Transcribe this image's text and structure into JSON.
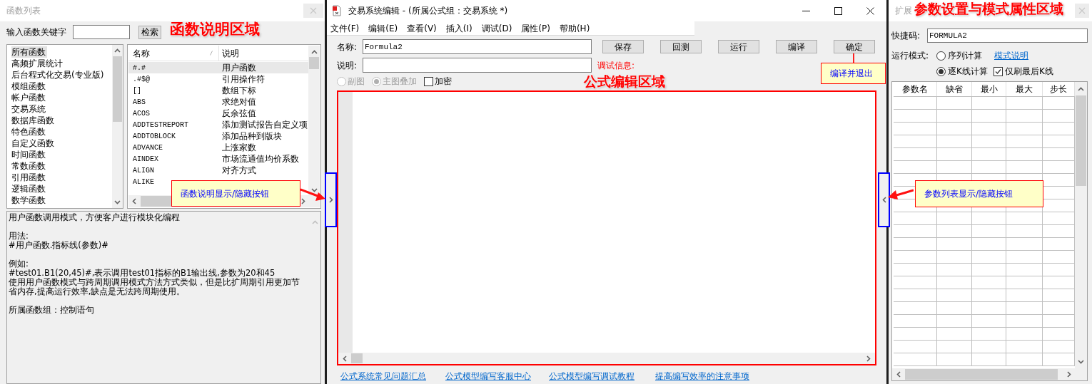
{
  "function_panel": {
    "title": "函数列表",
    "search_label": "输入函数关键字",
    "search_button": "检索",
    "categories": [
      {
        "label": "所有函数",
        "selected": true
      },
      {
        "label": "高频扩展统计",
        "selected": false
      },
      {
        "label": "后台程式化交易(专业版)",
        "selected": false
      },
      {
        "label": "模组函数",
        "selected": false
      },
      {
        "label": "帐户函数",
        "selected": false
      },
      {
        "label": "交易系统",
        "selected": false
      },
      {
        "label": "数据库函数",
        "selected": false
      },
      {
        "label": "特色函数",
        "selected": false
      },
      {
        "label": "自定义函数",
        "selected": false
      },
      {
        "label": "时间函数",
        "selected": false
      },
      {
        "label": "常数函数",
        "selected": false
      },
      {
        "label": "引用函数",
        "selected": false
      },
      {
        "label": "逻辑函数",
        "selected": false
      },
      {
        "label": "数学函数",
        "selected": false
      }
    ],
    "columns": [
      "名称",
      "说明"
    ],
    "functions": [
      {
        "name": "#.#",
        "description": "用户函数",
        "selected": true
      },
      {
        "name": ".#$@",
        "description": "引用操作符",
        "selected": false
      },
      {
        "name": "[]",
        "description": "数组下标",
        "selected": false
      },
      {
        "name": "ABS",
        "description": "求绝对值",
        "selected": false
      },
      {
        "name": "ACOS",
        "description": "反余弦值",
        "selected": false
      },
      {
        "name": "ADDTESTREPORT",
        "description": "添加测试报告自定义项",
        "selected": false
      },
      {
        "name": "ADDTOBLOCK",
        "description": "添加品种到版块",
        "selected": false
      },
      {
        "name": "ADVANCE",
        "description": "上涨家数",
        "selected": false
      },
      {
        "name": "AINDEX",
        "description": "市场流通值均价系数",
        "selected": false
      },
      {
        "name": "ALIGN",
        "description": "对齐方式",
        "selected": false
      },
      {
        "name": "ALIKE",
        "selected": false
      }
    ],
    "description": [
      [
        "用户函数调用模式，方便客户进行模块化编程"
      ],
      [
        "用法:",
        "#用户函数.指标线(参数)#"
      ],
      [
        "例如:",
        "#test01.B1(20,45)#,表示调用test01指标的B1输出线,参数为20和45",
        "使用用户函数模式与跨周期调用模式方法方式类似，但是比扩周期引用更加节省内存,提高运行效率,缺点是无法跨周期使用。"
      ],
      [
        "所属函数组：控制语句"
      ]
    ]
  },
  "editor": {
    "title": "交易系统编辑 - (所属公式组：交易系统 *)",
    "menu": [
      "文件(F)",
      "编辑(E)",
      "查看(V)",
      "插入(I)",
      "调试(D)",
      "属性(P)",
      "帮助(H)"
    ],
    "name_label": "名称:",
    "name_value": "Formula2",
    "buttons": [
      "保存",
      "回测",
      "运行",
      "编译",
      "确定"
    ],
    "description_label": "说明:",
    "debug_label": "调试信息:",
    "options": [
      {
        "kind": "radio",
        "label": "副图",
        "checked": false,
        "disabled": true
      },
      {
        "kind": "radio",
        "label": "主图叠加",
        "checked": true,
        "disabled": true
      },
      {
        "kind": "checkbox",
        "label": "加密",
        "checked": false,
        "disabled": false
      }
    ],
    "links": [
      "公式系统常见问题汇总",
      "公式模型编写客服中心",
      "公式模型编写调试教程",
      "提高编写效率的注意事项"
    ]
  },
  "params_panel": {
    "title": "扩展",
    "shortcut_label": "快捷码:",
    "shortcut_value": "FORMULA2",
    "mode_label": "运行模式:",
    "modes": [
      {
        "label": "序列计算",
        "selected": false
      },
      {
        "label": "逐K线计算",
        "selected": true
      }
    ],
    "mode_help_link": "模式说明",
    "last_bar_only": {
      "label": "仅刷最后K线",
      "checked": true
    },
    "columns": [
      "参数名",
      "缺省",
      "最小",
      "最大",
      "步长"
    ]
  },
  "annotations": [
    {
      "kind": "heading",
      "text": "函数说明区域"
    },
    {
      "kind": "heading",
      "text": "公式编辑区域"
    },
    {
      "kind": "heading",
      "text": "参数设置与模式属性区域"
    },
    {
      "kind": "callout",
      "text": "函数说明显示/隐藏按钮"
    },
    {
      "kind": "callout",
      "text": "编译并退出"
    },
    {
      "kind": "callout",
      "text": "参数列表显示/隐藏按钮"
    }
  ]
}
